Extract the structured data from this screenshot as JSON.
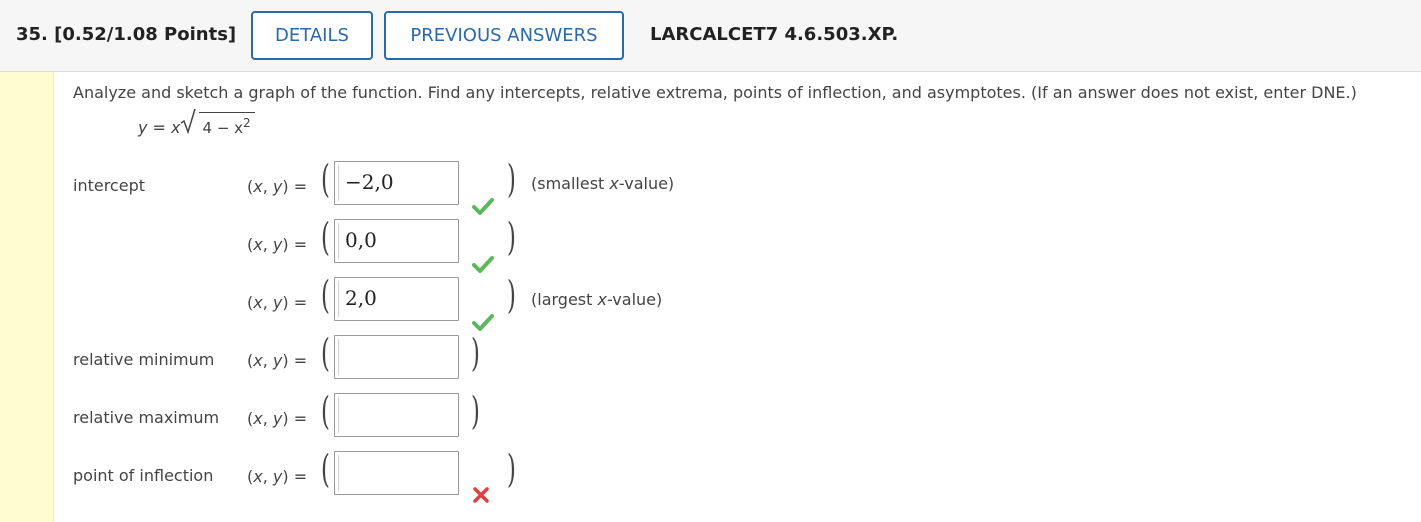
{
  "header": {
    "question_number": "35.",
    "points": "[0.52/1.08 Points]",
    "details_label": "DETAILS",
    "previous_answers_label": "PREVIOUS ANSWERS",
    "source": "LARCALCET7 4.6.503.XP."
  },
  "question": {
    "instructions": "Analyze and sketch a graph of the function. Find any intercepts, relative extrema, points of inflection, and asymptotes. (If an answer does not exist, enter DNE.)",
    "formula": {
      "lhs": "y",
      "eq": " = ",
      "x": "x",
      "radicand": "4 − x",
      "exponent": "2"
    }
  },
  "xy_label": {
    "open": "(",
    "x": "x",
    "comma": ", ",
    "y": "y",
    "close": ") ="
  },
  "rows": [
    {
      "label": "intercept",
      "value": "−2,0",
      "status": "correct",
      "note_prefix": "(smallest ",
      "note_var": "x",
      "note_suffix": "-value)"
    },
    {
      "label": "",
      "value": "0,0",
      "status": "correct",
      "note_prefix": "",
      "note_var": "",
      "note_suffix": ""
    },
    {
      "label": "",
      "value": "2,0",
      "status": "correct",
      "note_prefix": "(largest ",
      "note_var": "x",
      "note_suffix": "-value)"
    },
    {
      "label": "relative minimum",
      "value": "",
      "status": "none",
      "note_prefix": "",
      "note_var": "",
      "note_suffix": ""
    },
    {
      "label": "relative maximum",
      "value": "",
      "status": "none",
      "note_prefix": "",
      "note_var": "",
      "note_suffix": ""
    },
    {
      "label": "point of inflection",
      "value": "",
      "status": "incorrect",
      "note_prefix": "",
      "note_var": "",
      "note_suffix": ""
    }
  ],
  "colors": {
    "accent": "#2a6aa8",
    "correct": "#5cb85c",
    "incorrect": "#e04040",
    "sidebar": "#fdfdd0"
  }
}
